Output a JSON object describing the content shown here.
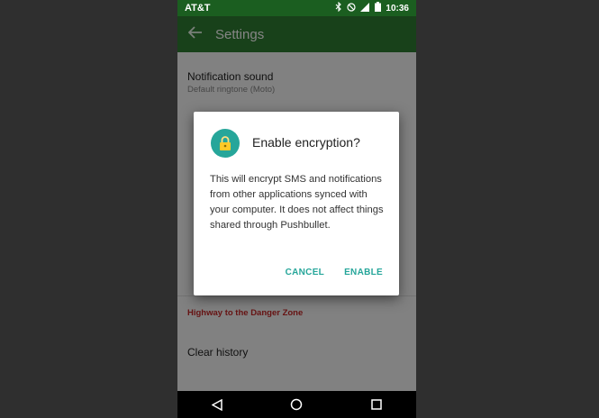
{
  "status": {
    "carrier": "AT&T",
    "time": "10:36",
    "icons": [
      "bluetooth-icon",
      "do-not-disturb-icon",
      "signal-icon",
      "battery-icon"
    ]
  },
  "appbar": {
    "title": "Settings",
    "back_icon": "arrow-left-icon"
  },
  "settings": {
    "notification_sound": {
      "label": "Notification sound",
      "sub": "Default ringtone (Moto)"
    },
    "section_danger": "Highway to the Danger Zone",
    "clear_history": "Clear history"
  },
  "dialog": {
    "icon": "lock-icon",
    "title": "Enable encryption?",
    "body": "This will encrypt SMS and notifications from other applications synced with your computer. It does not affect things shared through Pushbullet.",
    "cancel_label": "CANCEL",
    "enable_label": "ENABLE"
  },
  "navbar": {
    "back_icon": "nav-back-icon",
    "home_icon": "nav-home-icon",
    "recents_icon": "nav-recents-icon"
  },
  "colors": {
    "status_bar": "#1b5e20",
    "app_bar": "#2e7d32",
    "accent": "#26a69a",
    "danger": "#c62828"
  }
}
